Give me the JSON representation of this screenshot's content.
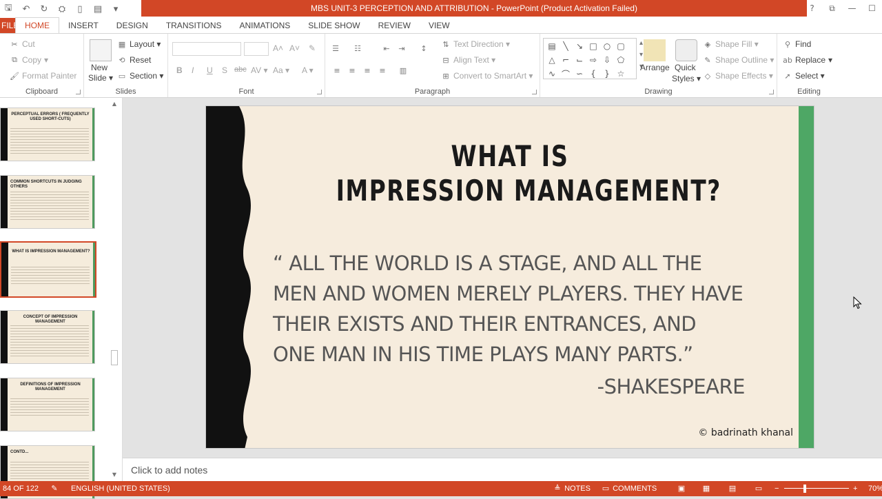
{
  "window": {
    "title": "MBS UNIT-3 PERCEPTION AND ATTRIBUTION -  PowerPoint (Product Activation Failed)",
    "controls": [
      "?",
      "⧉",
      "—",
      "☐"
    ]
  },
  "tabs": [
    "FILE",
    "HOME",
    "INSERT",
    "DESIGN",
    "TRANSITIONS",
    "ANIMATIONS",
    "SLIDE SHOW",
    "REVIEW",
    "VIEW"
  ],
  "ribbon": {
    "clipboard": {
      "cut": "Cut",
      "copy": "Copy",
      "format_painter": "Format Painter",
      "label": "Clipboard"
    },
    "slides": {
      "new_slide": "New",
      "new_slide2": "Slide ▾",
      "layout": "Layout ▾",
      "reset": "Reset",
      "section": "Section ▾",
      "label": "Slides"
    },
    "font": {
      "bold": "B",
      "italic": "I",
      "underline": "U",
      "shadow": "S",
      "strike": "abc",
      "spacing": "AV ▾",
      "case": "Aa ▾",
      "color": "A ▾",
      "grow": "A˄",
      "shrink": "A˅",
      "clear": "✎",
      "label": "Font"
    },
    "paragraph": {
      "text_direction": "Text Direction ▾",
      "align_text": "Align Text ▾",
      "smartart": "Convert to SmartArt ▾",
      "label": "Paragraph"
    },
    "drawing": {
      "arrange": "Arrange",
      "quick_styles": "Quick",
      "quick_styles2": "Styles ▾",
      "shape_fill": "Shape Fill ▾",
      "shape_outline": "Shape Outline ▾",
      "shape_effects": "Shape Effects ▾",
      "label": "Drawing"
    },
    "editing": {
      "find": "Find",
      "replace": "Replace",
      "select": "Select ▾",
      "label": "Editing"
    }
  },
  "thumbnails": [
    {
      "title": "PERCEPTUAL ERRORS ( FREQUENTLY USED SHORT-CUTS)",
      "selected": false
    },
    {
      "title": "COMMON SHORTCUTS IN JUDGING OTHERS",
      "selected": false
    },
    {
      "title": "WHAT IS IMPRESSION MANAGEMENT?",
      "selected": true
    },
    {
      "title": "CONCEPT OF IMPRESSION MANAGEMENT",
      "selected": false
    },
    {
      "title": "DEFINITIONS OF IMPRESSION MANAGEMENT",
      "selected": false
    },
    {
      "title": "CONTD...",
      "selected": false
    }
  ],
  "slide": {
    "title_line1": "WHAT IS",
    "title_line2": "IMPRESSION MANAGEMENT?",
    "quote_lines": [
      "“  ALL THE WORLD  IS  A STAGE,  AND ALL THE",
      "MEN AND WOMEN MERELY PLAYERS. THEY HAVE",
      "THEIR  EXISTS  AND  THEIR  ENTRANCES,  AND",
      "ONE MAN IN HIS TIME PLAYS MANY PARTS.”"
    ],
    "author": "-SHAKESPEARE",
    "copyright": "© badrinath khanal",
    "colors": {
      "background": "#f6ecdd",
      "left_band": "#111111",
      "right_band": "#4ea765"
    }
  },
  "notes": {
    "placeholder": "Click to add notes"
  },
  "status": {
    "slide_counter": "84 OF 122",
    "language": "ENGLISH (UNITED STATES)",
    "notes": "NOTES",
    "comments": "COMMENTS",
    "zoom": "70%"
  },
  "colors": {
    "accent": "#d24726"
  }
}
